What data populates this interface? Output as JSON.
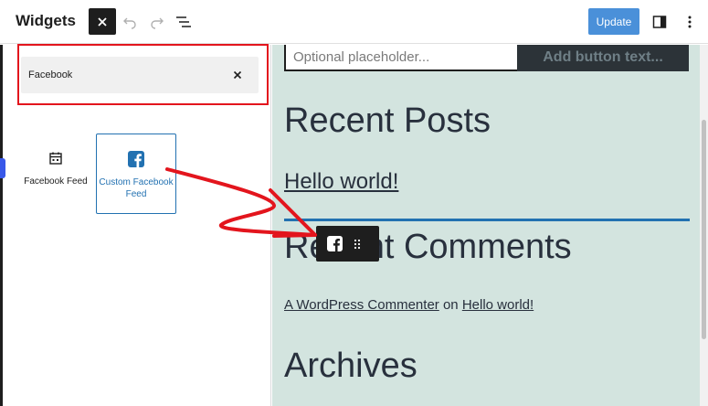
{
  "header": {
    "title": "Widgets",
    "update_label": "Update"
  },
  "inserter": {
    "search_value": "Facebook",
    "blocks": [
      {
        "label": "Facebook Feed",
        "icon": "calendar-icon"
      },
      {
        "label": "Custom Facebook Feed",
        "icon": "facebook-icon"
      }
    ]
  },
  "canvas": {
    "input_placeholder": "Optional placeholder...",
    "button_text": "Add button text...",
    "recent_posts_heading": "Recent Posts",
    "hello_world_link": "Hello world!",
    "recent_comments_heading": "Recent Comments",
    "comment": {
      "author": "A WordPress Commenter",
      "on": "on",
      "post": "Hello world!"
    },
    "archives_heading": "Archives"
  },
  "colors": {
    "accent": "#2271b1",
    "annotation": "#e3151d",
    "canvas_bg": "#d3e4df",
    "update_button": "#4a90d9"
  }
}
